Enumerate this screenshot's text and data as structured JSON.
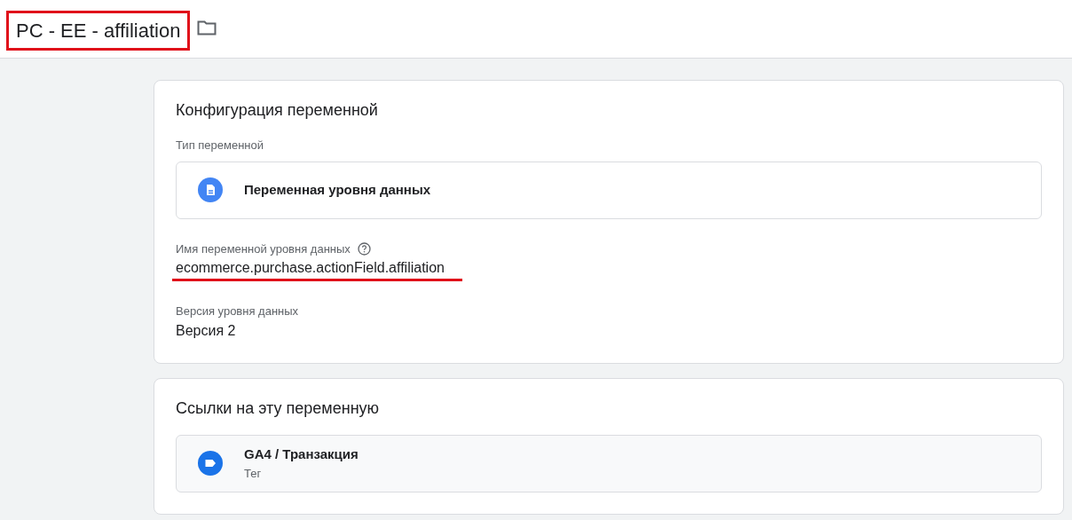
{
  "header": {
    "title": "PC - EE - affiliation"
  },
  "configuration": {
    "title": "Конфигурация переменной",
    "type_label": "Тип переменной",
    "type_name": "Переменная уровня данных",
    "name_label": "Имя переменной уровня данных",
    "name_value": "ecommerce.purchase.actionField.affiliation",
    "version_label": "Версия уровня данных",
    "version_value": "Версия 2"
  },
  "references": {
    "title": "Ссылки на эту переменную",
    "items": [
      {
        "name": "GA4 / Транзакция",
        "type": "Тег"
      }
    ]
  }
}
